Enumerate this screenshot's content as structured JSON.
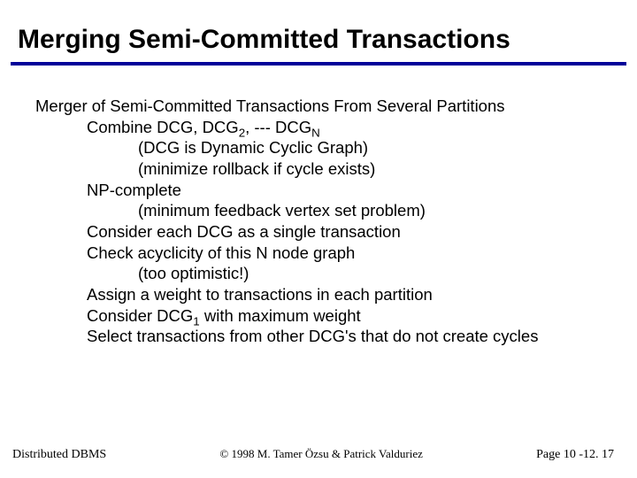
{
  "title": "Merging Semi-Committed Transactions",
  "lines": {
    "l0": "Merger of Semi-Committed Transactions From Several Partitions",
    "l1a": "Combine DCG, DCG",
    "l1b": ", --- DCG",
    "sub2": "2",
    "subN": "N",
    "l2": "(DCG is Dynamic Cyclic Graph)",
    "l3": "(minimize rollback if cycle exists)",
    "l4": "NP-complete",
    "l5": "(minimum feedback vertex set problem)",
    "l6": "Consider each DCG as a single transaction",
    "l7": "Check acyclicity of this N node graph",
    "l8": "(too optimistic!)",
    "l9": "Assign a weight to transactions in each partition",
    "l10a": "Consider DCG",
    "sub1": "1",
    "l10b": " with maximum weight",
    "l11": "Select transactions from other DCG's that do not create cycles"
  },
  "footer": {
    "left": "Distributed DBMS",
    "center": "© 1998 M. Tamer Özsu & Patrick Valduriez",
    "right": "Page 10 -12. 17"
  }
}
